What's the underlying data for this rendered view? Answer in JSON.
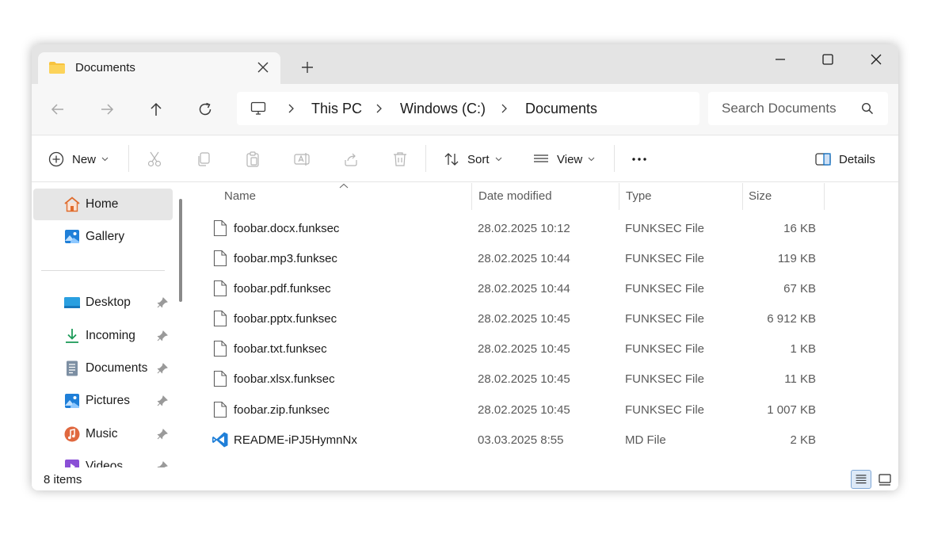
{
  "tab": {
    "title": "Documents"
  },
  "breadcrumb": [
    "This PC",
    "Windows (C:)",
    "Documents"
  ],
  "search": {
    "placeholder": "Search Documents"
  },
  "commands": {
    "new": "New",
    "sort": "Sort",
    "view": "View",
    "details": "Details"
  },
  "sidebar": {
    "items": [
      {
        "label": "Home",
        "icon": "home-icon",
        "active": true
      },
      {
        "label": "Gallery",
        "icon": "gallery-icon"
      },
      {
        "label": "Desktop",
        "icon": "desktop-icon",
        "pinned": true
      },
      {
        "label": "Incoming",
        "icon": "download-icon",
        "pinned": true
      },
      {
        "label": "Documents",
        "icon": "documents-icon",
        "pinned": true
      },
      {
        "label": "Pictures",
        "icon": "pictures-icon",
        "pinned": true
      },
      {
        "label": "Music",
        "icon": "music-icon",
        "pinned": true
      },
      {
        "label": "Videos",
        "icon": "videos-icon",
        "pinned": true
      }
    ]
  },
  "columns": {
    "name": "Name",
    "date": "Date modified",
    "type": "Type",
    "size": "Size"
  },
  "files": [
    {
      "name": "foobar.docx.funksec",
      "date": "28.02.2025 10:12",
      "type": "FUNKSEC File",
      "size": "16 KB",
      "icon": "file-icon"
    },
    {
      "name": "foobar.mp3.funksec",
      "date": "28.02.2025 10:44",
      "type": "FUNKSEC File",
      "size": "119 KB",
      "icon": "file-icon"
    },
    {
      "name": "foobar.pdf.funksec",
      "date": "28.02.2025 10:44",
      "type": "FUNKSEC File",
      "size": "67 KB",
      "icon": "file-icon"
    },
    {
      "name": "foobar.pptx.funksec",
      "date": "28.02.2025 10:45",
      "type": "FUNKSEC File",
      "size": "6 912 KB",
      "icon": "file-icon"
    },
    {
      "name": "foobar.txt.funksec",
      "date": "28.02.2025 10:45",
      "type": "FUNKSEC File",
      "size": "1 KB",
      "icon": "file-icon"
    },
    {
      "name": "foobar.xlsx.funksec",
      "date": "28.02.2025 10:45",
      "type": "FUNKSEC File",
      "size": "11 KB",
      "icon": "file-icon"
    },
    {
      "name": "foobar.zip.funksec",
      "date": "28.02.2025 10:45",
      "type": "FUNKSEC File",
      "size": "1 007 KB",
      "icon": "file-icon"
    },
    {
      "name": "README-iPJ5HymnNx",
      "date": "03.03.2025 8:55",
      "type": "MD File",
      "size": "2 KB",
      "icon": "vscode-icon"
    }
  ],
  "status": {
    "count": "8 items"
  },
  "colors": {
    "accent": "#0067c0",
    "folder": "#f8c33f",
    "titlebar": "#e4e4e4"
  }
}
